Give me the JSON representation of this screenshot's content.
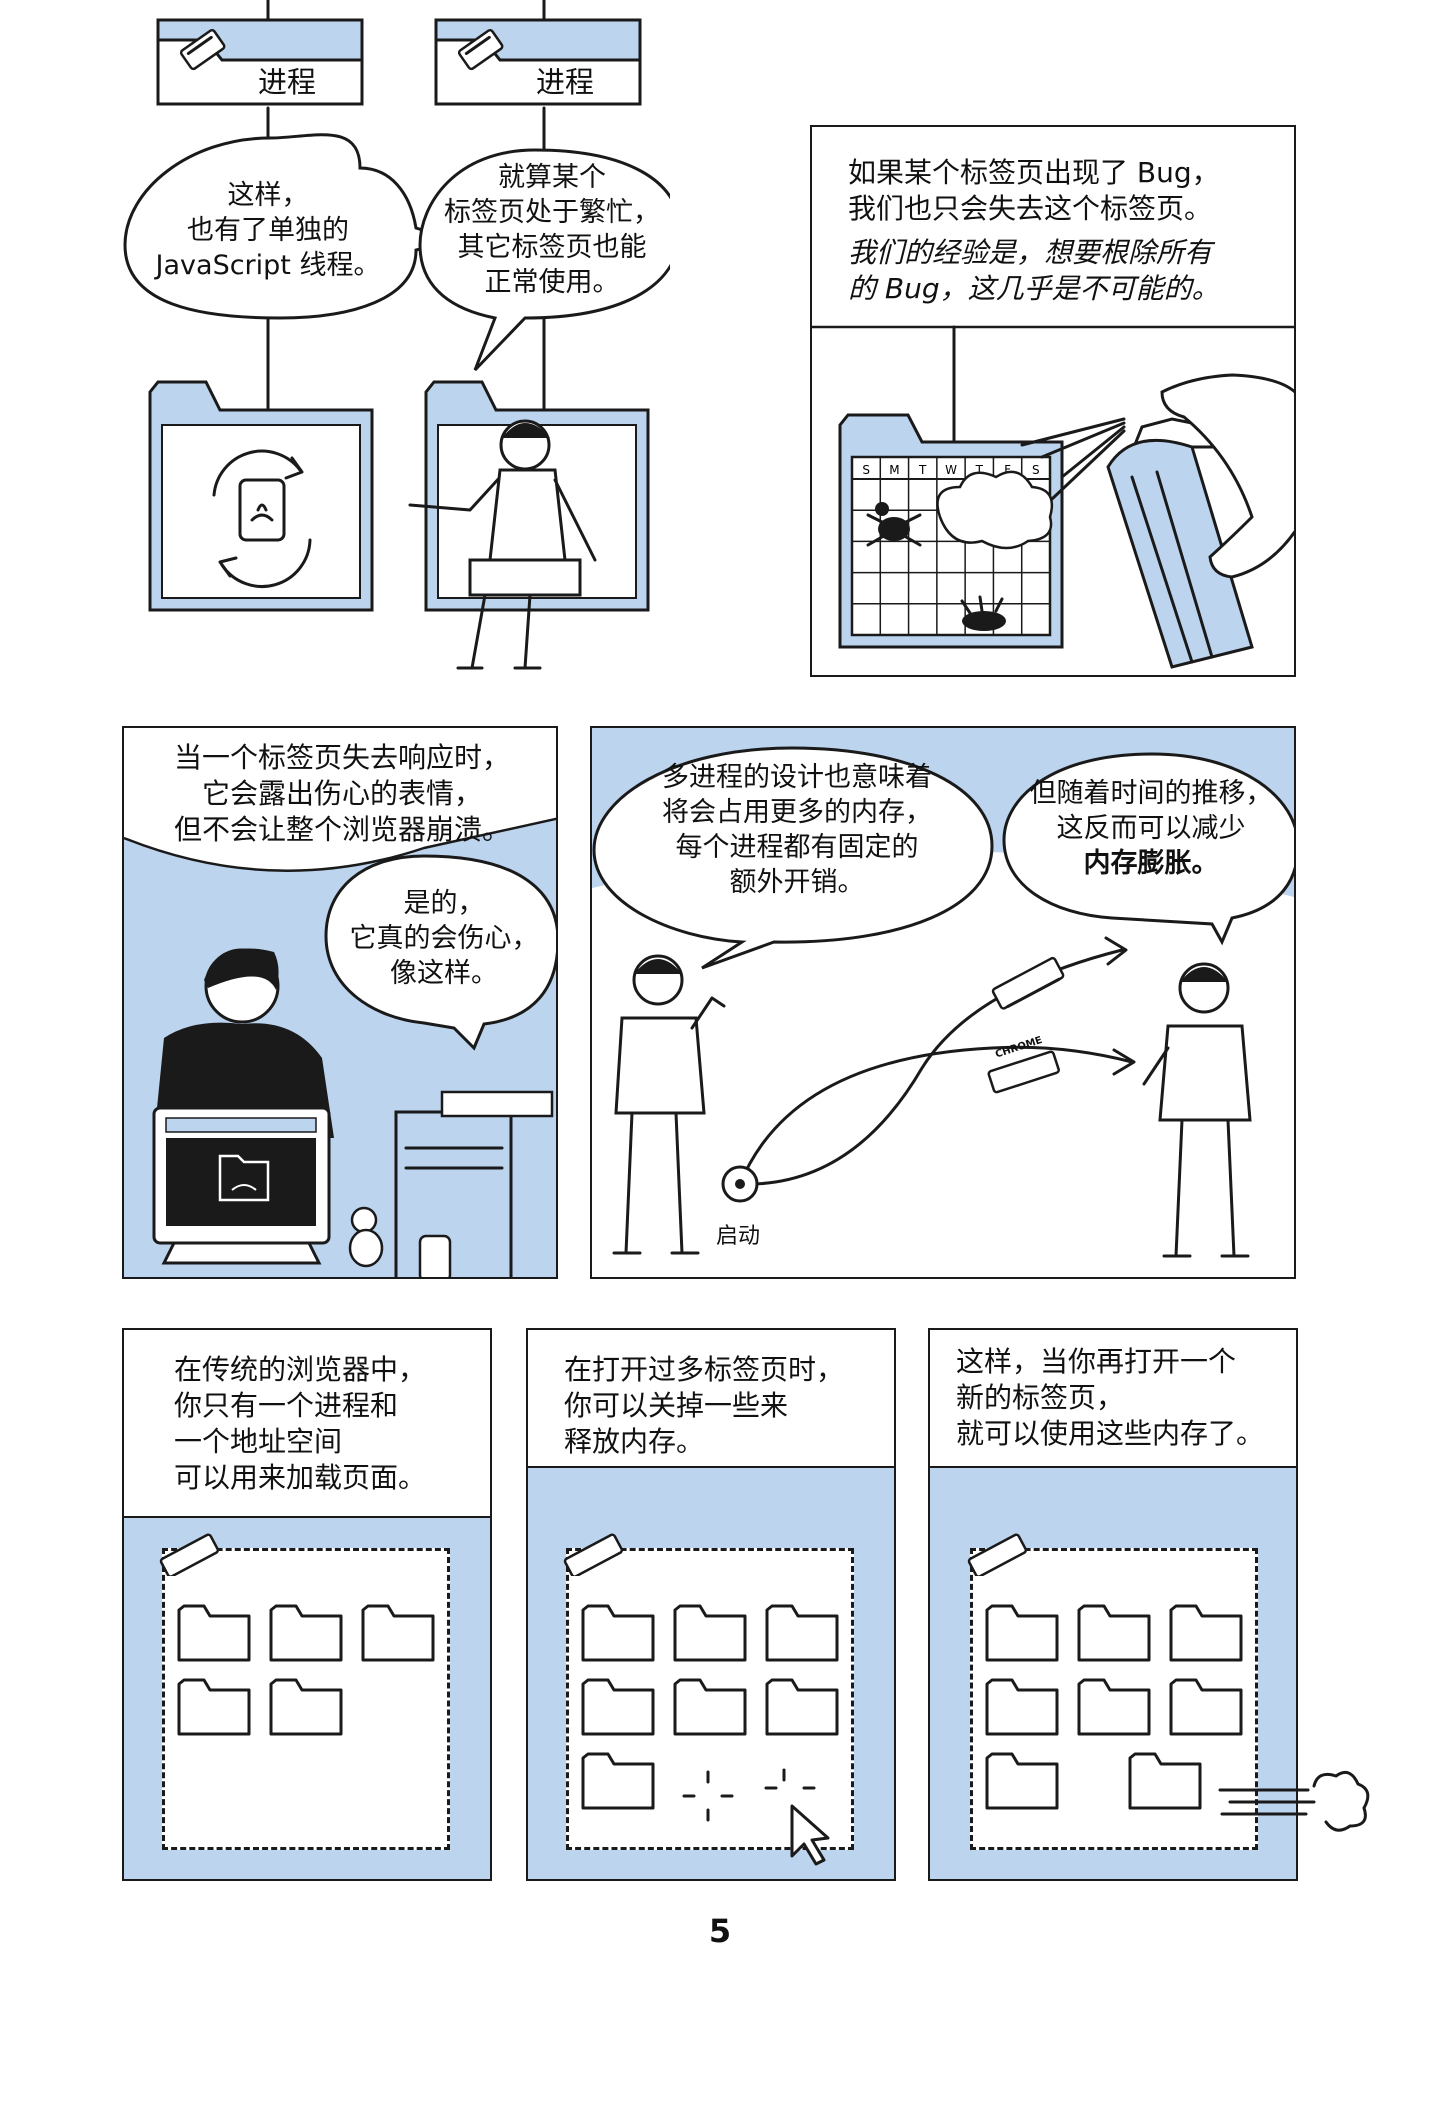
{
  "row1": {
    "tab_label_left": "进程",
    "tab_label_right": "进程",
    "bubble_left": [
      "这样，",
      "也有了单独的",
      "JavaScript 线程。"
    ],
    "bubble_right": [
      "就算某个",
      "标签页处于繁忙，",
      "其它标签页也能",
      "正常使用。"
    ],
    "bug_panel": {
      "caption": [
        "如果某个标签页出现了 Bug，",
        "我们也只会失去这个标签页。"
      ],
      "caption_italic": [
        "我们的经验是，想要根除所有",
        "的 Bug，这几乎是不可能的。"
      ],
      "calendar_days": [
        "S",
        "M",
        "T",
        "W",
        "T",
        "F",
        "S"
      ]
    }
  },
  "row2": {
    "sad_panel": {
      "caption": [
        "当一个标签页失去响应时，",
        "它会露出伤心的表情，",
        "但不会让整个浏览器崩溃。"
      ],
      "bubble": [
        "是的，",
        "它真的会伤心，",
        "像这样。"
      ]
    },
    "memory_panel": {
      "bubble_left": [
        "多进程的设计也意味着",
        "将会占用更多的内存，",
        "每个进程都有固定的",
        "额外开销。"
      ],
      "bubble_right": [
        "但随着时间的推移，",
        "这反而可以减少"
      ],
      "bubble_right_bold": "内存膨胀。",
      "start_label": "启动",
      "chip_label": "CHROME"
    }
  },
  "row3": {
    "panels": [
      {
        "caption": [
          "在传统的浏览器中，",
          "你只有一个进程和",
          "一个地址空间",
          "可以用来加载页面。"
        ],
        "folders": 5
      },
      {
        "caption": [
          "在打开过多标签页时，",
          "你可以关掉一些来",
          "释放内存。"
        ],
        "folders": 7
      },
      {
        "caption": [
          "这样，当你再打开一个",
          "新的标签页，",
          "就可以使用这些内存了。"
        ],
        "folders": 8
      }
    ]
  },
  "page_number": "5",
  "colors": {
    "accent_blue": "#bcd4ee",
    "ink": "#1a1a1a"
  }
}
